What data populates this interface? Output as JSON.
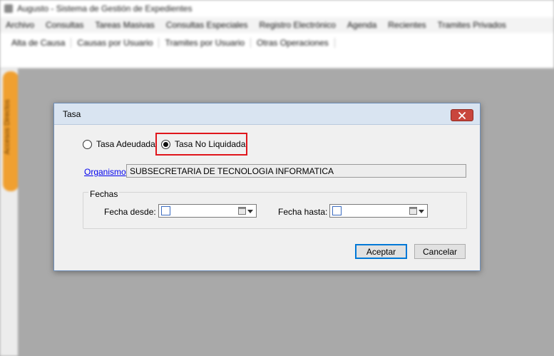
{
  "app": {
    "title": "Augusto - Sistema de Gestión de Expedientes",
    "menu": [
      "Archivo",
      "Consultas",
      "Tareas Masivas",
      "Consultas Especiales",
      "Registro Electrónico",
      "Agenda",
      "Recientes",
      "Tramites Privados"
    ],
    "toolbar": [
      "Alta de Causa",
      "Causas por Usuario",
      "Tramites por Usuario",
      "Otras Operaciones"
    ],
    "side_tab": "Accesos Directos"
  },
  "dialog": {
    "title": "Tasa",
    "close_icon": "close-x-icon",
    "radio_options": [
      {
        "label": "Tasa Adeudada",
        "checked": false
      },
      {
        "label": "Tasa No Liquidada",
        "checked": true
      }
    ],
    "highlight_color": "#e0161c",
    "organismo": {
      "link_label": "Organismo",
      "value": "SUBSECRETARIA DE TECNOLOGIA INFORMATICA"
    },
    "fechas": {
      "legend": "Fechas",
      "desde_label": "Fecha desde:",
      "desde_value": "",
      "hasta_label": "Fecha hasta:",
      "hasta_value": ""
    },
    "buttons": {
      "accept": "Aceptar",
      "cancel": "Cancelar"
    }
  }
}
